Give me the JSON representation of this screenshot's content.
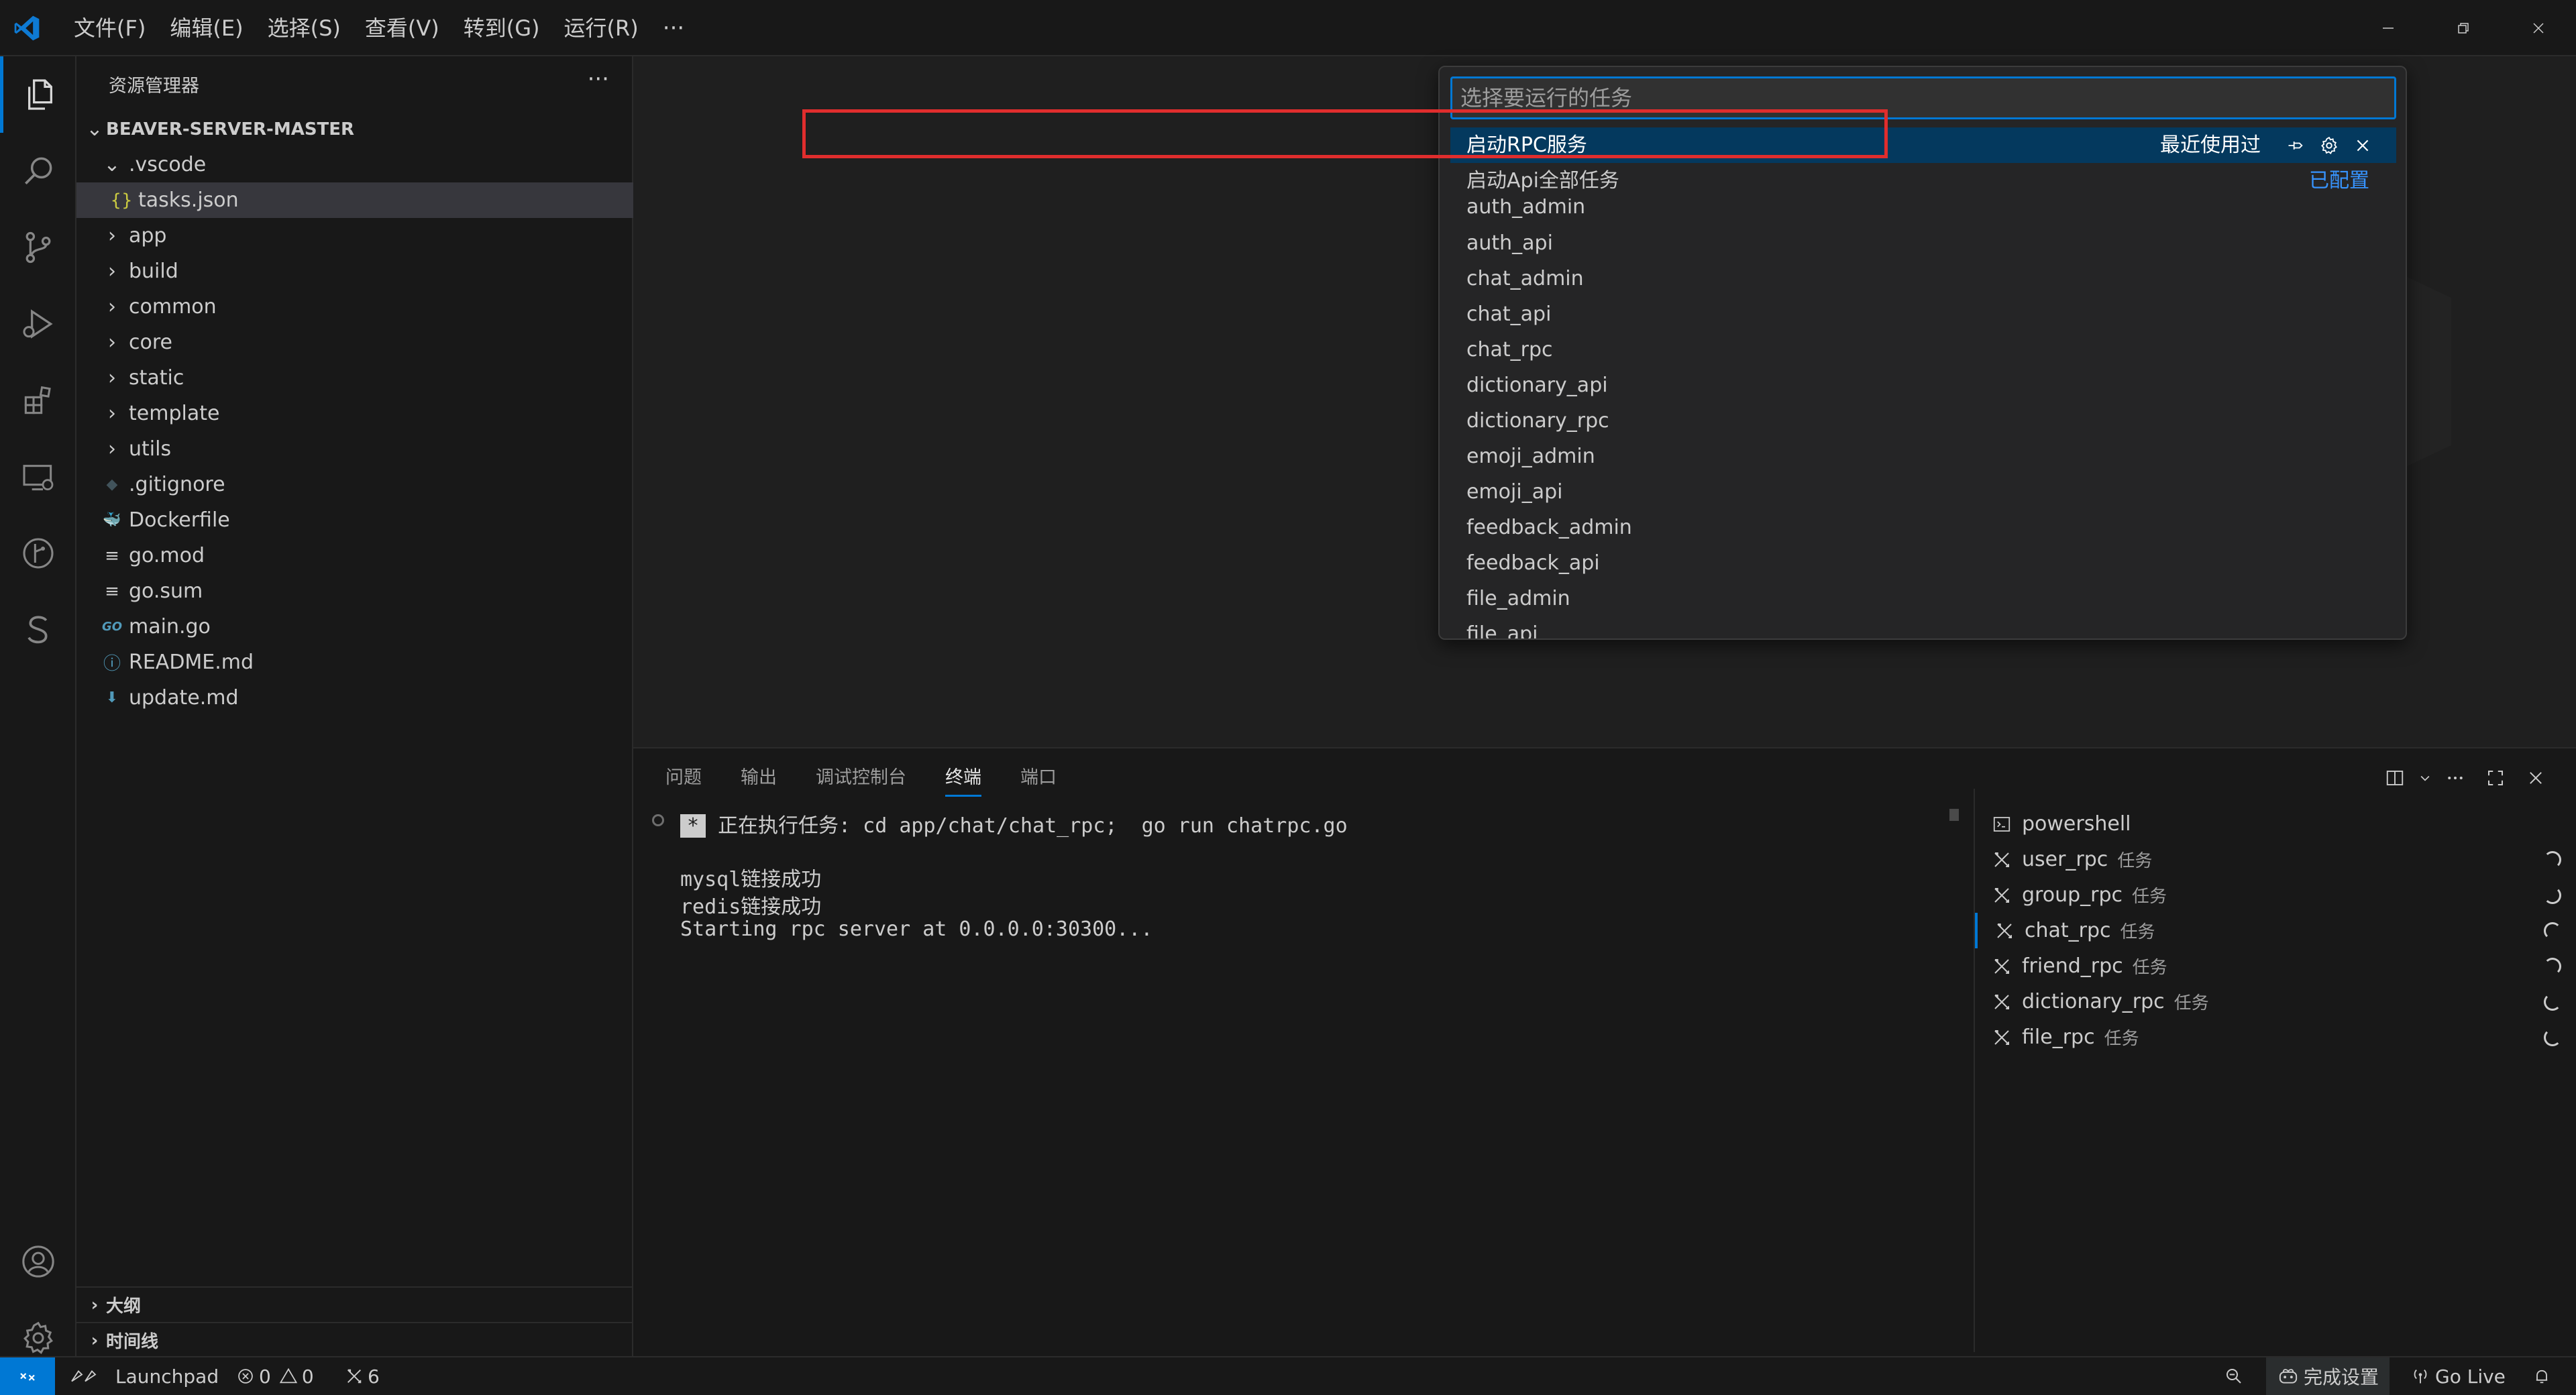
{
  "menubar": {
    "items": [
      "文件(F)",
      "编辑(E)",
      "选择(S)",
      "查看(V)",
      "转到(G)",
      "运行(R)"
    ],
    "more": "···"
  },
  "sidebar": {
    "title": "资源管理器",
    "more": "···",
    "root": "BEAVER-SERVER-MASTER",
    "tree": [
      {
        "label": ".vscode",
        "type": "folder-open",
        "icon": "chevron-down-icon"
      },
      {
        "label": "tasks.json",
        "type": "file",
        "icon": "json-braces-icon",
        "glyph": "{}"
      },
      {
        "label": "app",
        "type": "folder",
        "icon": "chevron-right-icon"
      },
      {
        "label": "build",
        "type": "folder",
        "icon": "chevron-right-icon"
      },
      {
        "label": "common",
        "type": "folder",
        "icon": "chevron-right-icon"
      },
      {
        "label": "core",
        "type": "folder",
        "icon": "chevron-right-icon"
      },
      {
        "label": "static",
        "type": "folder",
        "icon": "chevron-right-icon"
      },
      {
        "label": "template",
        "type": "folder",
        "icon": "chevron-right-icon"
      },
      {
        "label": "utils",
        "type": "folder",
        "icon": "chevron-right-icon"
      },
      {
        "label": ".gitignore",
        "type": "file",
        "icon": "git-diamond-icon",
        "glyph": "◆"
      },
      {
        "label": "Dockerfile",
        "type": "file",
        "icon": "docker-whale-icon",
        "glyph": "🐳"
      },
      {
        "label": "go.mod",
        "type": "file",
        "icon": "lines-icon",
        "glyph": "≡"
      },
      {
        "label": "go.sum",
        "type": "file",
        "icon": "lines-icon",
        "glyph": "≡"
      },
      {
        "label": "main.go",
        "type": "file",
        "icon": "go-gopher-icon",
        "glyph": "GO"
      },
      {
        "label": "README.md",
        "type": "file",
        "icon": "info-icon",
        "glyph": "ⓘ"
      },
      {
        "label": "update.md",
        "type": "file",
        "icon": "markdown-down-icon",
        "glyph": "⬇"
      }
    ],
    "sections": [
      "大纲",
      "时间线"
    ]
  },
  "quickpick": {
    "placeholder": "选择要运行的任务",
    "selected": {
      "label": "启动RPC服务",
      "tag": "最近使用过"
    },
    "highlighted": {
      "label": "启动Api全部任务",
      "tag": "已配置"
    },
    "items": [
      "auth_admin",
      "auth_api",
      "chat_admin",
      "chat_api",
      "chat_rpc",
      "dictionary_api",
      "dictionary_rpc",
      "emoji_admin",
      "emoji_api",
      "feedback_admin",
      "feedback_api",
      "file_admin",
      "file_api"
    ]
  },
  "panel": {
    "tabs": [
      "问题",
      "输出",
      "调试控制台",
      "终端",
      "端口"
    ],
    "active_tab": "终端",
    "terminal": {
      "task_line": "正在执行任务: cd app/chat/chat_rpc;  go run chatrpc.go",
      "star": "*",
      "lines": [
        "mysql链接成功",
        "redis链接成功",
        "Starting rpc server at 0.0.0.0:30300..."
      ]
    },
    "terminals": [
      {
        "label": "powershell",
        "sub": "",
        "icon": "terminal-icon"
      },
      {
        "label": "user_rpc",
        "sub": "任务",
        "icon": "tools-icon"
      },
      {
        "label": "group_rpc",
        "sub": "任务",
        "icon": "tools-icon"
      },
      {
        "label": "chat_rpc",
        "sub": "任务",
        "icon": "tools-icon"
      },
      {
        "label": "friend_rpc",
        "sub": "任务",
        "icon": "tools-icon"
      },
      {
        "label": "dictionary_rpc",
        "sub": "任务",
        "icon": "tools-icon"
      },
      {
        "label": "file_rpc",
        "sub": "任务",
        "icon": "tools-icon"
      }
    ]
  },
  "statusbar": {
    "launchpad": "Launchpad",
    "errors": "0",
    "warnings": "0",
    "ports": "6",
    "setup": "完成设置",
    "golive": "Go Live"
  },
  "colors": {
    "accent": "#0078d4",
    "highlight_box": "#e02d2d",
    "selection": "#04395e",
    "configured": "#3794ff"
  }
}
